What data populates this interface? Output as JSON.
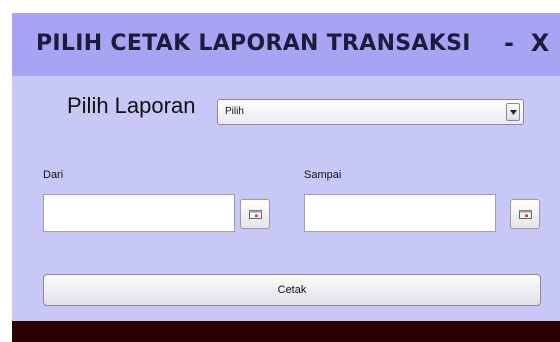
{
  "window": {
    "title": "PILIH CETAK LAPORAN TRANSAKSI",
    "minimize_label": "-",
    "close_label": "X"
  },
  "form": {
    "report_label": "Pilih Laporan",
    "report_select": {
      "selected": "Pilih"
    },
    "from_label": "Dari",
    "from_value": "",
    "to_label": "Sampai",
    "to_value": "",
    "print_button": "Cetak"
  },
  "colors": {
    "titlebar": "#a9a3f3",
    "panel": "#c8c8f6",
    "bottom_bar": "#2a0000"
  },
  "icons": {
    "calendar_button": "calendar-icon",
    "dropdown_arrow": "chevron-down-icon"
  }
}
